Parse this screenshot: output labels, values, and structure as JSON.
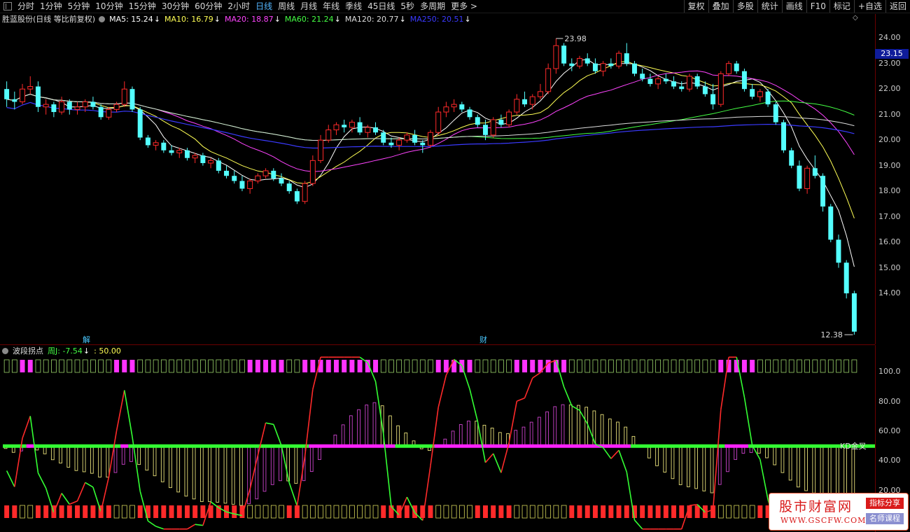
{
  "toolbar": {
    "periods": [
      "分时",
      "1分钟",
      "5分钟",
      "10分钟",
      "15分钟",
      "30分钟",
      "60分钟",
      "2小时",
      "日线",
      "周线",
      "月线",
      "年线",
      "季线",
      "45日线",
      "5秒",
      "多周期",
      "更多 >"
    ],
    "active_period": "日线",
    "right": [
      "复权",
      "叠加",
      "多股",
      "统计",
      "画线",
      "F10",
      "标记",
      "+自选",
      "返回"
    ]
  },
  "legend_main": {
    "title": "胜蓝股份(日线 等比前复权)",
    "items": [
      {
        "label": "MA5: 15.24",
        "color": "#ffffff",
        "arrow": "↓"
      },
      {
        "label": "MA10: 16.79",
        "color": "#ffff55",
        "arrow": "↓"
      },
      {
        "label": "MA20: 18.87",
        "color": "#ff44ff",
        "arrow": "↓"
      },
      {
        "label": "MA60: 21.24",
        "color": "#44ff44",
        "arrow": "↓"
      },
      {
        "label": "MA120: 20.77",
        "color": "#dddddd",
        "arrow": "↓"
      },
      {
        "label": "MA250: 20.51",
        "color": "#3a3aff",
        "arrow": "↓"
      }
    ]
  },
  "legend_sub": {
    "title": "波段拐点",
    "items": [
      {
        "label": "周J: -7.54",
        "color": "#44ff44",
        "arrow": "↓"
      },
      {
        "label": ": 50.00",
        "color": "#ffff55",
        "arrow": ""
      }
    ]
  },
  "price_axis": {
    "ticks": [
      "24.00",
      "23.00",
      "22.00",
      "21.00",
      "20.00",
      "19.00",
      "18.00",
      "17.00",
      "16.00",
      "15.00",
      "14.00"
    ],
    "current": "23.15"
  },
  "sub_axis": {
    "ticks": [
      "100.0",
      "80.00",
      "60.00",
      "40.00",
      "20.00"
    ]
  },
  "annotations": {
    "high": "23.98",
    "low": "12.38",
    "kd_label": "KD金叉",
    "marker_1": "解",
    "marker_2": "财"
  },
  "watermark": {
    "name": "股市财富网",
    "url": "WWW.GSCFW.COM",
    "badge1": "指标分享",
    "badge2": "名师课程"
  },
  "colors": {
    "up": "#ff2a2a",
    "down": "#54ffff",
    "ma5": "#ffffff",
    "ma10": "#ffff55",
    "ma20": "#ff44ff",
    "ma60": "#44ff44",
    "ma120": "#dddddd",
    "ma250": "#3a3aff"
  },
  "chart_data": {
    "type": "candlestick",
    "ohlc": [
      [
        22.0,
        22.3,
        21.3,
        21.6
      ],
      [
        21.6,
        21.9,
        21.2,
        21.5
      ],
      [
        21.5,
        22.2,
        21.4,
        22.0
      ],
      [
        22.0,
        22.5,
        21.8,
        22.1
      ],
      [
        22.1,
        22.3,
        21.1,
        21.3
      ],
      [
        21.3,
        21.6,
        21.0,
        21.4
      ],
      [
        21.4,
        21.5,
        20.9,
        21.1
      ],
      [
        21.1,
        21.7,
        21.0,
        21.5
      ],
      [
        21.5,
        21.6,
        21.0,
        21.2
      ],
      [
        21.2,
        21.5,
        21.0,
        21.3
      ],
      [
        21.3,
        21.6,
        21.1,
        21.5
      ],
      [
        21.5,
        21.7,
        21.2,
        21.3
      ],
      [
        21.3,
        21.4,
        20.8,
        20.9
      ],
      [
        20.9,
        21.3,
        20.8,
        21.2
      ],
      [
        21.2,
        21.5,
        21.1,
        21.4
      ],
      [
        21.4,
        22.3,
        21.3,
        22.0
      ],
      [
        22.0,
        22.1,
        21.1,
        21.2
      ],
      [
        21.2,
        21.3,
        20.0,
        20.1
      ],
      [
        20.1,
        20.2,
        19.7,
        19.8
      ],
      [
        19.8,
        20.0,
        19.6,
        19.9
      ],
      [
        19.9,
        20.0,
        19.5,
        19.6
      ],
      [
        19.6,
        19.8,
        19.4,
        19.5
      ],
      [
        19.5,
        19.7,
        19.3,
        19.6
      ],
      [
        19.6,
        19.7,
        19.2,
        19.3
      ],
      [
        19.3,
        19.5,
        19.1,
        19.4
      ],
      [
        19.4,
        19.5,
        19.0,
        19.1
      ],
      [
        19.1,
        19.3,
        18.9,
        19.2
      ],
      [
        19.2,
        19.3,
        18.7,
        18.8
      ],
      [
        18.8,
        19.0,
        18.5,
        18.6
      ],
      [
        18.6,
        18.8,
        18.3,
        18.4
      ],
      [
        18.4,
        18.6,
        18.0,
        18.1
      ],
      [
        18.1,
        18.5,
        17.9,
        18.4
      ],
      [
        18.4,
        18.7,
        18.3,
        18.6
      ],
      [
        18.6,
        18.9,
        18.5,
        18.8
      ],
      [
        18.8,
        18.9,
        18.4,
        18.5
      ],
      [
        18.5,
        18.7,
        18.2,
        18.3
      ],
      [
        18.3,
        18.4,
        17.9,
        18.0
      ],
      [
        18.0,
        18.1,
        17.5,
        17.6
      ],
      [
        17.6,
        18.4,
        17.5,
        18.3
      ],
      [
        18.3,
        19.4,
        18.2,
        19.2
      ],
      [
        19.2,
        20.2,
        19.1,
        20.0
      ],
      [
        20.0,
        20.6,
        19.9,
        20.4
      ],
      [
        20.4,
        20.7,
        20.2,
        20.6
      ],
      [
        20.6,
        20.8,
        20.3,
        20.5
      ],
      [
        20.5,
        20.8,
        20.3,
        20.7
      ],
      [
        20.7,
        20.9,
        20.2,
        20.3
      ],
      [
        20.3,
        20.6,
        20.1,
        20.5
      ],
      [
        20.5,
        20.7,
        20.2,
        20.3
      ],
      [
        20.3,
        20.4,
        19.8,
        19.9
      ],
      [
        19.9,
        20.1,
        19.7,
        19.8
      ],
      [
        19.8,
        20.1,
        19.6,
        20.0
      ],
      [
        20.0,
        20.3,
        19.9,
        20.2
      ],
      [
        20.2,
        20.4,
        19.8,
        19.9
      ],
      [
        19.9,
        20.0,
        19.5,
        19.8
      ],
      [
        19.8,
        20.4,
        19.7,
        20.3
      ],
      [
        20.3,
        21.3,
        20.2,
        21.1
      ],
      [
        21.1,
        21.5,
        20.9,
        21.3
      ],
      [
        21.3,
        21.6,
        21.1,
        21.4
      ],
      [
        21.4,
        21.5,
        21.1,
        21.2
      ],
      [
        21.2,
        21.3,
        20.8,
        20.9
      ],
      [
        20.9,
        21.0,
        20.5,
        20.6
      ],
      [
        20.6,
        20.8,
        20.0,
        20.2
      ],
      [
        20.2,
        20.9,
        20.1,
        20.8
      ],
      [
        20.8,
        21.0,
        20.5,
        20.6
      ],
      [
        20.6,
        21.2,
        20.5,
        21.1
      ],
      [
        21.1,
        21.8,
        21.0,
        21.6
      ],
      [
        21.6,
        21.9,
        21.3,
        21.4
      ],
      [
        21.4,
        21.8,
        21.2,
        21.7
      ],
      [
        21.7,
        22.2,
        21.6,
        21.9
      ],
      [
        21.9,
        23.0,
        21.8,
        22.8
      ],
      [
        22.8,
        23.98,
        22.6,
        23.7
      ],
      [
        23.7,
        23.8,
        22.9,
        23.0
      ],
      [
        23.0,
        23.2,
        22.7,
        22.9
      ],
      [
        22.9,
        23.3,
        22.8,
        23.2
      ],
      [
        23.2,
        23.4,
        22.9,
        23.0
      ],
      [
        23.0,
        23.2,
        22.6,
        22.7
      ],
      [
        22.7,
        23.1,
        22.5,
        23.0
      ],
      [
        23.0,
        23.2,
        22.8,
        22.9
      ],
      [
        22.9,
        23.5,
        22.8,
        23.4
      ],
      [
        23.4,
        23.8,
        22.9,
        23.0
      ],
      [
        23.0,
        23.1,
        22.5,
        22.6
      ],
      [
        22.6,
        22.8,
        22.3,
        22.4
      ],
      [
        22.4,
        22.6,
        22.1,
        22.2
      ],
      [
        22.2,
        22.5,
        22.0,
        22.4
      ],
      [
        22.4,
        22.6,
        22.2,
        22.3
      ],
      [
        22.3,
        22.5,
        22.0,
        22.1
      ],
      [
        22.1,
        22.3,
        21.9,
        22.0
      ],
      [
        22.0,
        22.6,
        21.9,
        22.5
      ],
      [
        22.5,
        22.6,
        22.0,
        22.1
      ],
      [
        22.1,
        22.3,
        21.7,
        21.8
      ],
      [
        21.8,
        22.2,
        21.2,
        21.4
      ],
      [
        21.4,
        22.7,
        21.3,
        22.6
      ],
      [
        22.6,
        23.1,
        22.5,
        23.0
      ],
      [
        23.0,
        23.1,
        22.6,
        22.7
      ],
      [
        22.7,
        22.8,
        21.9,
        22.0
      ],
      [
        22.0,
        22.2,
        21.6,
        21.7
      ],
      [
        21.7,
        22.0,
        21.5,
        21.9
      ],
      [
        21.9,
        22.0,
        21.3,
        21.4
      ],
      [
        21.4,
        21.5,
        20.6,
        20.7
      ],
      [
        20.7,
        20.8,
        19.5,
        19.6
      ],
      [
        19.6,
        19.7,
        18.9,
        19.0
      ],
      [
        19.0,
        19.2,
        18.0,
        18.1
      ],
      [
        18.1,
        19.0,
        17.9,
        18.9
      ],
      [
        18.9,
        19.4,
        18.5,
        18.6
      ],
      [
        18.6,
        18.7,
        17.2,
        17.4
      ],
      [
        17.4,
        17.5,
        16.0,
        16.1
      ],
      [
        16.1,
        16.3,
        15.0,
        15.2
      ],
      [
        15.2,
        15.3,
        13.8,
        14.0
      ],
      [
        14.0,
        14.1,
        12.38,
        12.5
      ]
    ],
    "ylim": [
      12.0,
      24.5
    ]
  }
}
